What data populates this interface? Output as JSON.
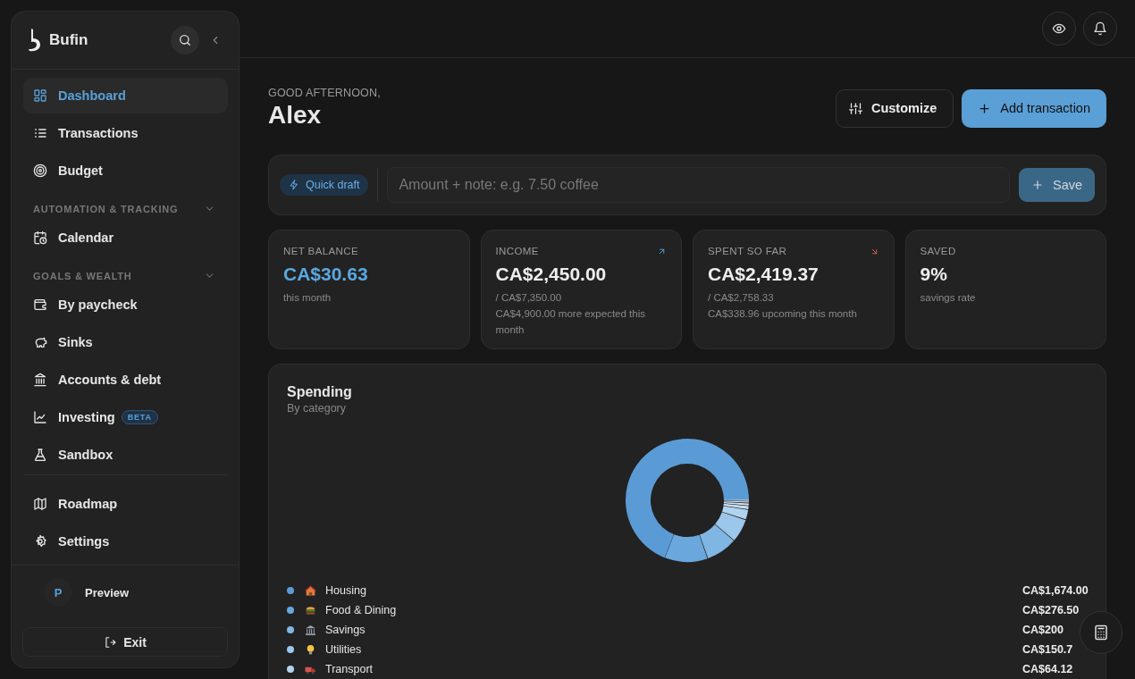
{
  "sidebar": {
    "brand": "Bufin",
    "items": [
      {
        "kind": "item",
        "label": "Dashboard",
        "selected": true
      },
      {
        "kind": "item",
        "label": "Transactions",
        "selected": false
      },
      {
        "kind": "item",
        "label": "Budget",
        "selected": false
      },
      {
        "kind": "section",
        "label": "AUTOMATION & TRACKING",
        "expanded": true
      },
      {
        "kind": "item",
        "label": "Calendar",
        "selected": false
      },
      {
        "kind": "section",
        "label": "GOALS & WEALTH",
        "expanded": true
      },
      {
        "kind": "item",
        "label": "By paycheck",
        "selected": false
      },
      {
        "kind": "item",
        "label": "Sinks",
        "selected": false
      },
      {
        "kind": "item",
        "label": "Accounts & debt",
        "selected": false
      },
      {
        "kind": "item",
        "label": "Investing",
        "badge": "BETA",
        "selected": false
      },
      {
        "kind": "item",
        "label": "Sandbox",
        "selected": false
      }
    ],
    "footer_items": [
      {
        "label": "Roadmap",
        "selected": false
      },
      {
        "label": "Settings",
        "selected": false
      }
    ],
    "user": {
      "initial": "P",
      "name": "Preview"
    },
    "exit": "Exit"
  },
  "header": {
    "greeting": "GOOD AFTERNOON,",
    "name": "Alex",
    "buttons": [
      {
        "kind": "secondary",
        "label": "Customize"
      },
      {
        "kind": "primary",
        "label": "Add transaction"
      }
    ]
  },
  "quick_draft": {
    "badge": "Quick draft",
    "placeholder": "Amount + note: e.g. 7.50 coffee",
    "button": "Save"
  },
  "stats": [
    {
      "title": "NET BALANCE",
      "value": "CA$30.63",
      "highlight": true,
      "kind": "balance",
      "lines": [
        "this month"
      ]
    },
    {
      "title": "INCOME",
      "value": "CA$2,450.00",
      "highlight": false,
      "kind": "income",
      "lines": [
        "/ CA$7,350.00",
        "CA$4,900.00 more expected this month"
      ]
    },
    {
      "title": "SPENT SO FAR",
      "value": "CA$2,419.37",
      "highlight": false,
      "kind": "expense",
      "lines": [
        "/ CA$2,758.33",
        "CA$338.96 upcoming this month"
      ]
    },
    {
      "title": "SAVED",
      "value": "9%",
      "highlight": false,
      "kind": "rate",
      "lines": [
        "savings rate"
      ]
    }
  ],
  "spending": {
    "title": "Spending",
    "subtitle": "By category",
    "categories": [
      {
        "name": "Housing",
        "amount": "CA$1,674.00",
        "color": "#5b9bd5"
      },
      {
        "name": "Food & Dining",
        "amount": "CA$276.50",
        "color": "#6aa7dc"
      },
      {
        "name": "Savings",
        "amount": "CA$200",
        "color": "#80b6e4"
      },
      {
        "name": "Utilities",
        "amount": "CA$150.7",
        "color": "#9cc6ea"
      },
      {
        "name": "Transport",
        "amount": "CA$64.12",
        "color": "#b2d3ef"
      }
    ]
  }
}
